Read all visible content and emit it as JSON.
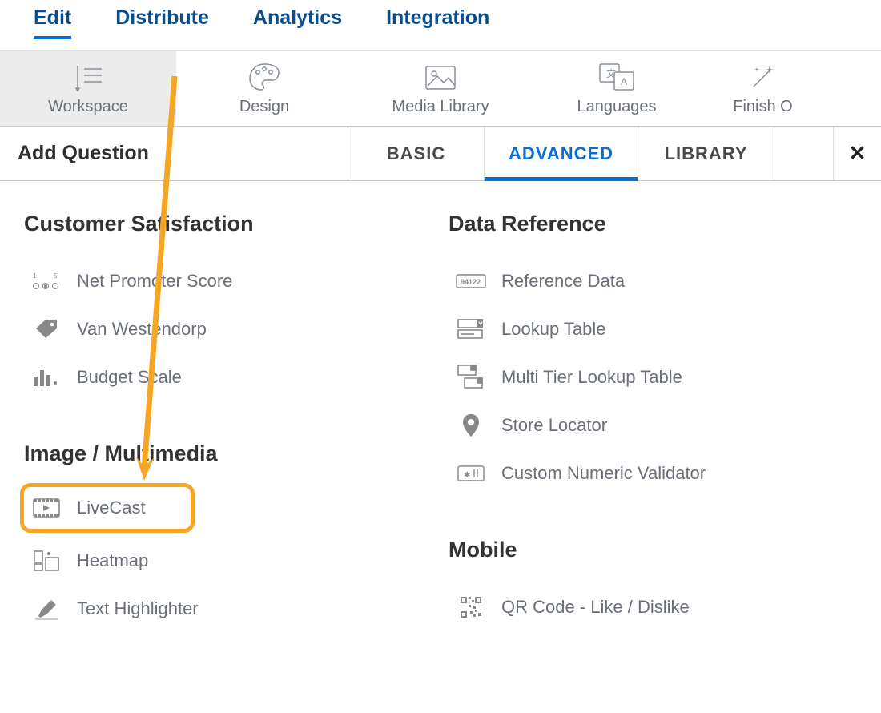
{
  "top_nav": {
    "items": [
      {
        "label": "Edit",
        "active": true
      },
      {
        "label": "Distribute",
        "active": false
      },
      {
        "label": "Analytics",
        "active": false
      },
      {
        "label": "Integration",
        "active": false
      }
    ]
  },
  "toolbar": {
    "items": [
      {
        "label": "Workspace",
        "icon": "workspace-icon",
        "active": true
      },
      {
        "label": "Design",
        "icon": "palette-icon",
        "active": false
      },
      {
        "label": "Media Library",
        "icon": "image-icon",
        "active": false
      },
      {
        "label": "Languages",
        "icon": "languages-icon",
        "active": false
      },
      {
        "label": "Finish O",
        "icon": "wand-icon",
        "active": false
      }
    ]
  },
  "sub_header": {
    "title": "Add Question",
    "tabs": [
      {
        "label": "BASIC",
        "active": false
      },
      {
        "label": "ADVANCED",
        "active": true
      },
      {
        "label": "LIBRARY",
        "active": false
      }
    ],
    "close": "✕"
  },
  "left_column": {
    "sections": [
      {
        "title": "Customer Satisfaction",
        "items": [
          {
            "label": "Net Promoter Score",
            "icon": "nps-icon"
          },
          {
            "label": "Van Westendorp",
            "icon": "tag-icon"
          },
          {
            "label": "Budget Scale",
            "icon": "bars-icon"
          }
        ]
      },
      {
        "title": "Image / Multimedia",
        "items": [
          {
            "label": "LiveCast",
            "icon": "film-icon",
            "highlighted": true
          },
          {
            "label": "Heatmap",
            "icon": "heatmap-icon"
          },
          {
            "label": "Text Highlighter",
            "icon": "highlighter-icon"
          }
        ]
      }
    ]
  },
  "right_column": {
    "sections": [
      {
        "title": "Data Reference",
        "items": [
          {
            "label": "Reference Data",
            "icon": "zipcode-icon"
          },
          {
            "label": "Lookup Table",
            "icon": "lookup-icon"
          },
          {
            "label": "Multi Tier Lookup Table",
            "icon": "multitier-icon"
          },
          {
            "label": "Store Locator",
            "icon": "pin-icon"
          },
          {
            "label": "Custom Numeric Validator",
            "icon": "validator-icon"
          }
        ]
      },
      {
        "title": "Mobile",
        "items": [
          {
            "label": "QR Code - Like / Dislike",
            "icon": "qr-icon"
          }
        ]
      }
    ]
  },
  "colors": {
    "accent": "#0a6dd6",
    "nav": "#0a4d8c",
    "text_muted": "#6a6f78",
    "highlight": "#f5a623"
  }
}
